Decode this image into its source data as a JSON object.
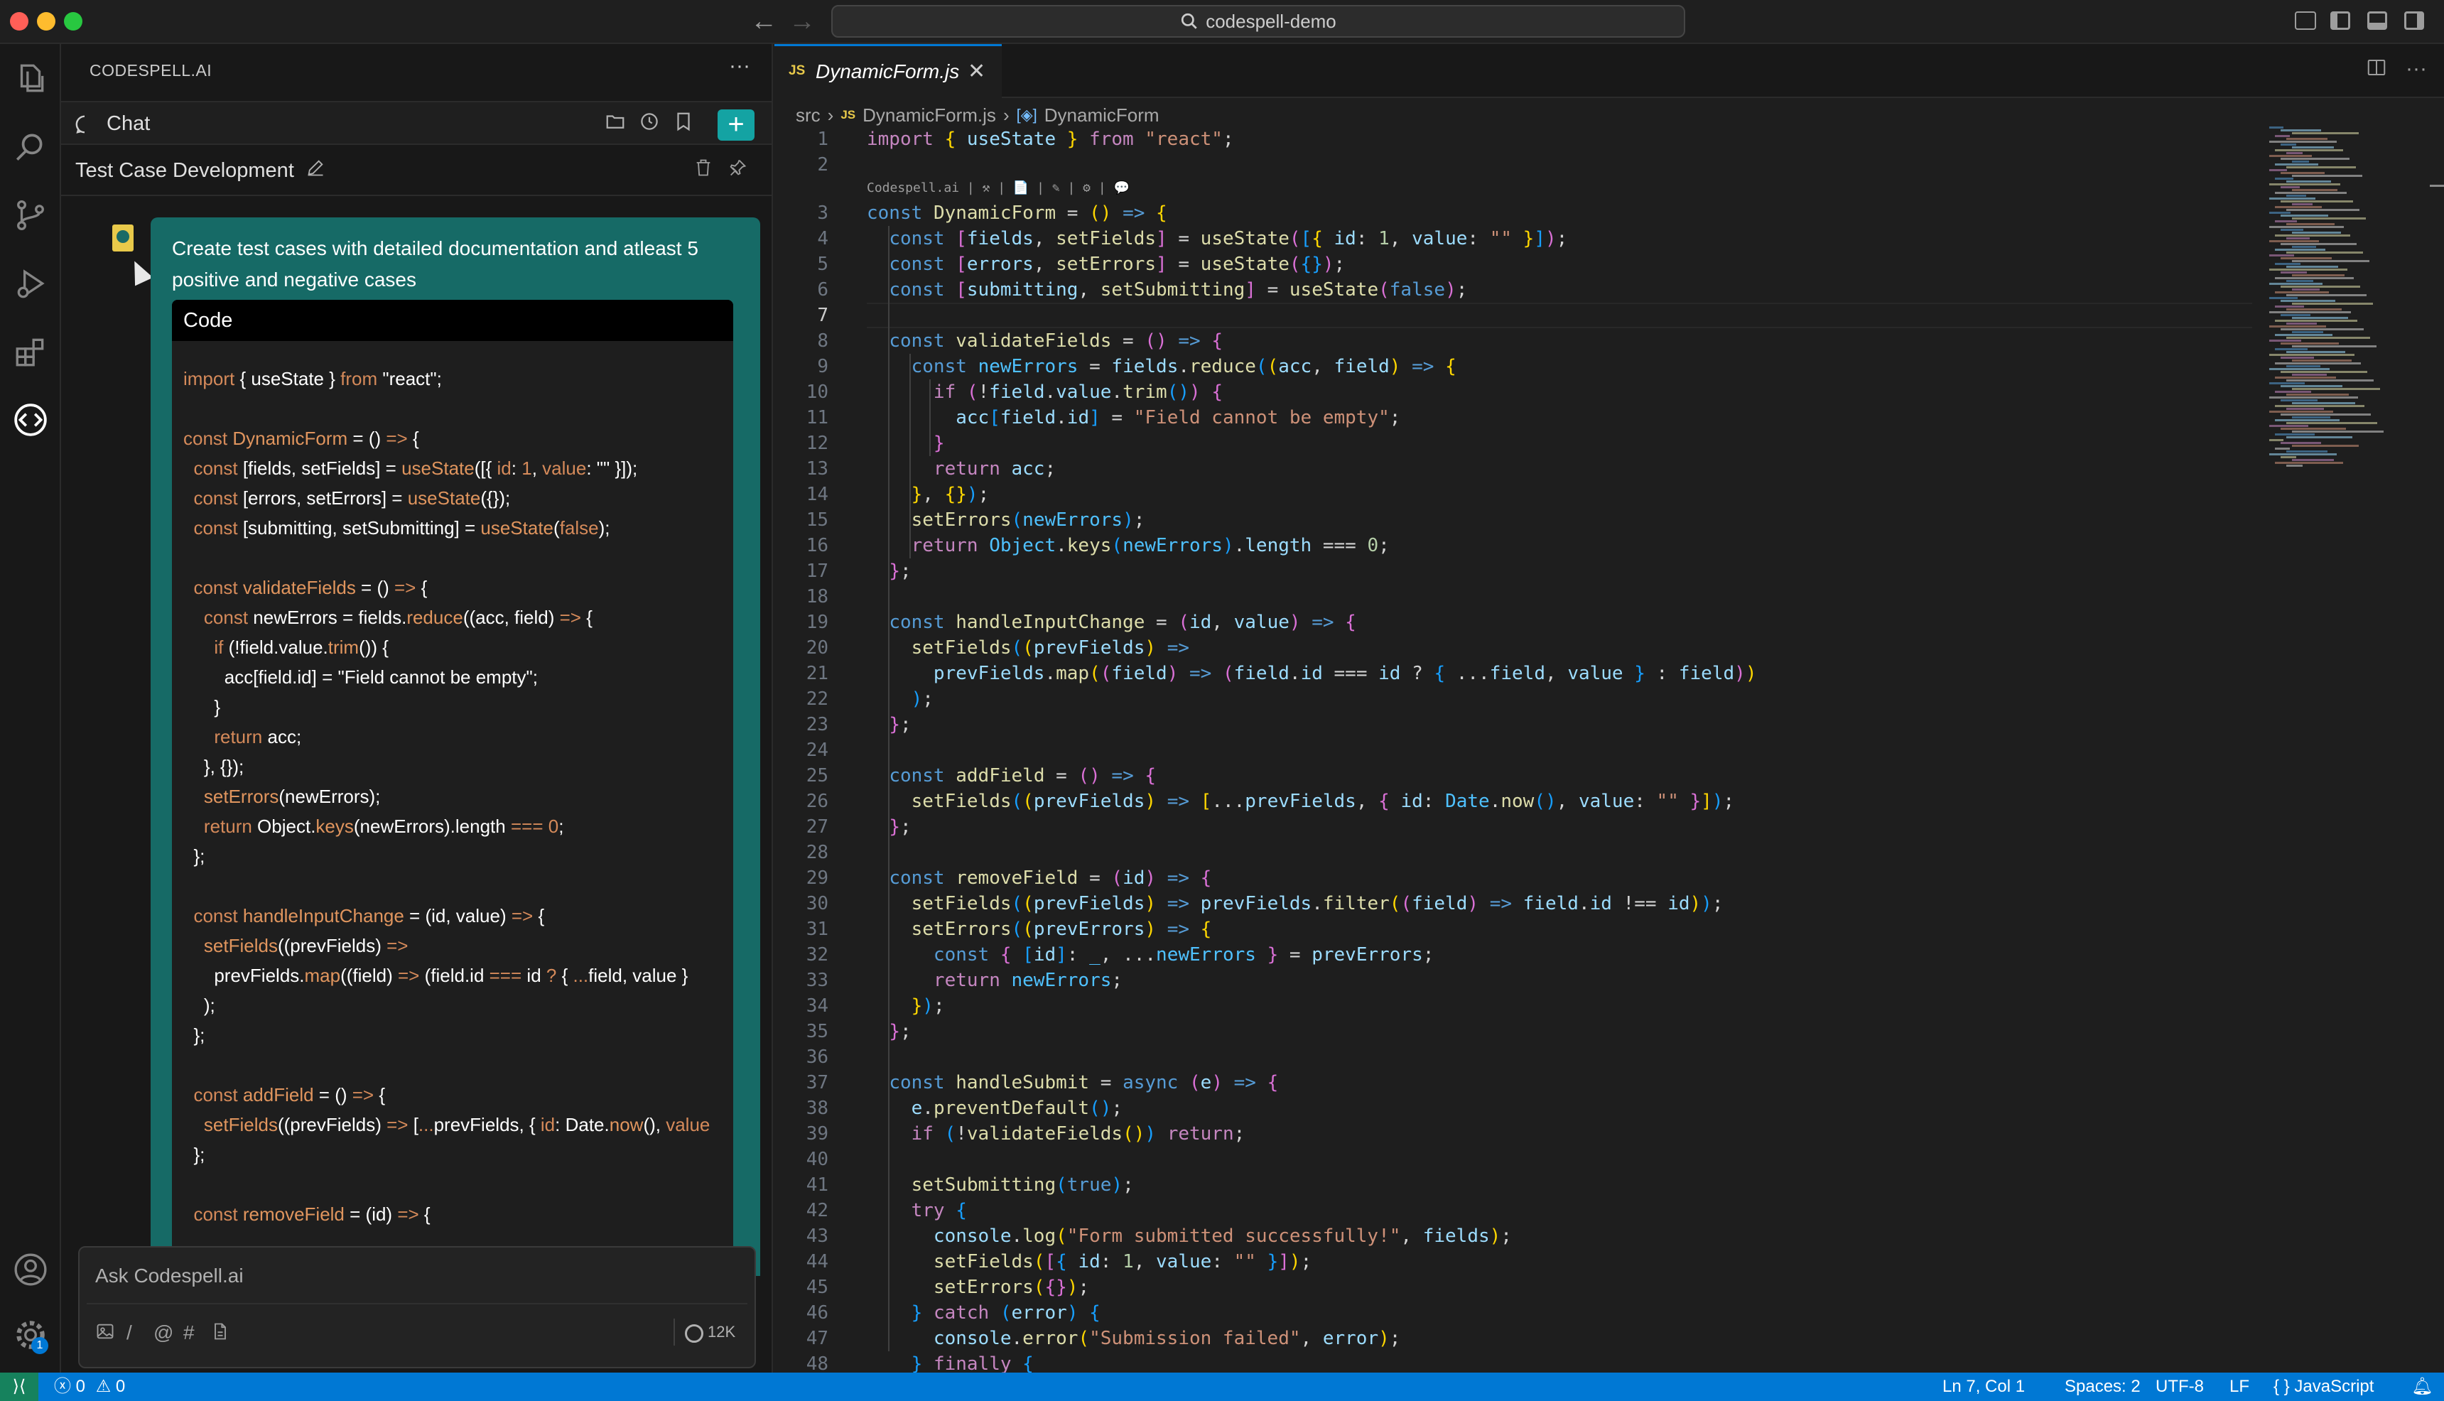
{
  "window": {
    "title": "codespell-demo",
    "traffic_colors": [
      "#ff5f57",
      "#febc2e",
      "#28c840"
    ]
  },
  "activity_bar": {
    "items": [
      "explorer-icon",
      "search-icon",
      "source-control-icon",
      "run-debug-icon",
      "extensions-icon",
      "codespell-icon"
    ],
    "bottom": [
      "account-icon",
      "manage-gear-icon"
    ],
    "gear_badge": "1"
  },
  "chat": {
    "brand": "CODESPELL.AI",
    "tab_label": "Chat",
    "conversation_title": "Test Case Development",
    "user_message": "Create test cases with detailed documentation and atleast 5 positive and negative cases",
    "code_header": "Code",
    "input_placeholder": "Ask Codespell.ai",
    "token_count": "12K",
    "accent": "#14a3a3",
    "bubble_color": "#166a66"
  },
  "editor": {
    "tab_badge": "JS",
    "tab_name": "DynamicForm.js",
    "breadcrumb": [
      "src",
      "DynamicForm.js",
      "DynamicForm"
    ],
    "active_line": 7,
    "code_lens": "Codespell.ai | ⚒ | 📄 | ✎ | ⚙ | 💬"
  },
  "status_bar": {
    "errors": "0",
    "warnings": "0",
    "position": "Ln 7, Col 1",
    "spaces": "Spaces: 2",
    "encoding": "UTF-8",
    "eol": "LF",
    "language": "JavaScript",
    "color": "#0078d4"
  }
}
